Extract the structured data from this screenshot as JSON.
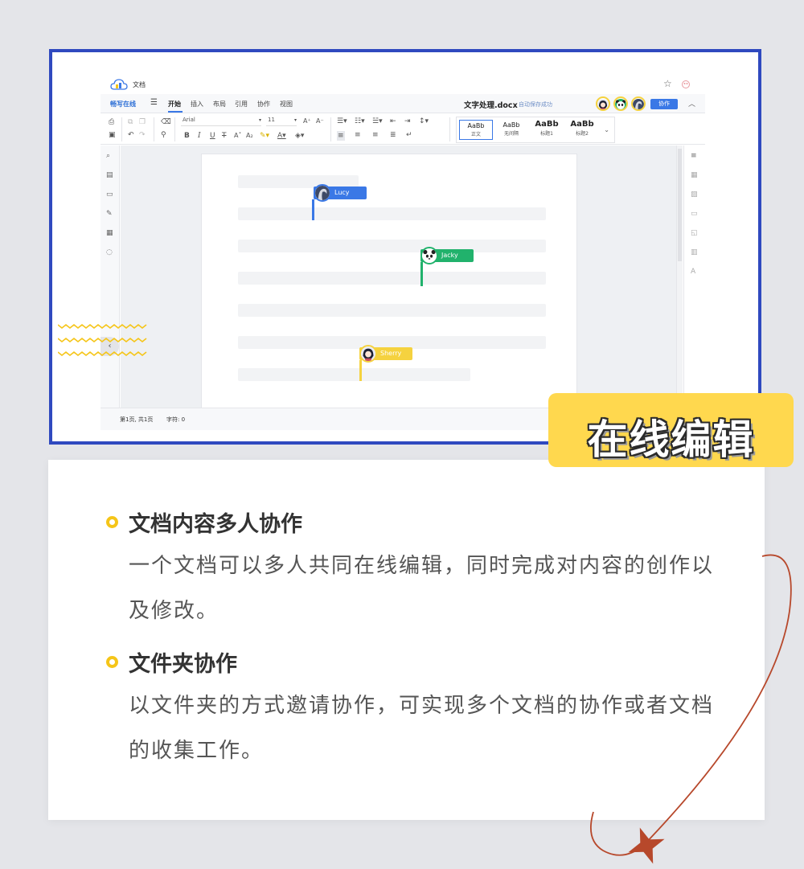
{
  "app": {
    "title": "文档",
    "brand": "畅写在线",
    "menus": [
      {
        "label": "开始",
        "active": true
      },
      {
        "label": "插入",
        "active": false
      },
      {
        "label": "布局",
        "active": false
      },
      {
        "label": "引用",
        "active": false
      },
      {
        "label": "协作",
        "active": false
      },
      {
        "label": "视图",
        "active": false
      }
    ],
    "document_name": "文字处理.docx",
    "autosave_status": "自动保存成功",
    "collab_button": "协作",
    "font_name": "Arial",
    "font_size": "11",
    "styles": [
      {
        "preview": "AaBb",
        "name": "正文",
        "selected": true
      },
      {
        "preview": "AaBb",
        "name": "无间隔",
        "selected": false
      },
      {
        "preview": "AaBb",
        "name": "标题1",
        "selected": false
      },
      {
        "preview": "AaBb",
        "name": "标题2",
        "selected": false
      }
    ],
    "status": {
      "page": "第1页, 共1页",
      "chars": "字符: 0"
    }
  },
  "collaborators": [
    {
      "name": "Lucy",
      "color": "#3a78e6"
    },
    {
      "name": "Jacky",
      "color": "#21b26c"
    },
    {
      "name": "Sherry",
      "color": "#f5d23f"
    }
  ],
  "badge": {
    "label": "在线编辑",
    "color": "#ffd84e"
  },
  "features": [
    {
      "title": "文档内容多人协作",
      "description": "一个文档可以多人共同在线编辑，同时完成对内容的创作以及修改。"
    },
    {
      "title": "文件夹协作",
      "description": "以文件夹的方式邀请协作，可实现多个文档的协作或者文档的收集工作。"
    }
  ],
  "colors": {
    "frame_border": "#2f49bf",
    "bullet": "#f5c518",
    "arrow": "#b7482b"
  }
}
